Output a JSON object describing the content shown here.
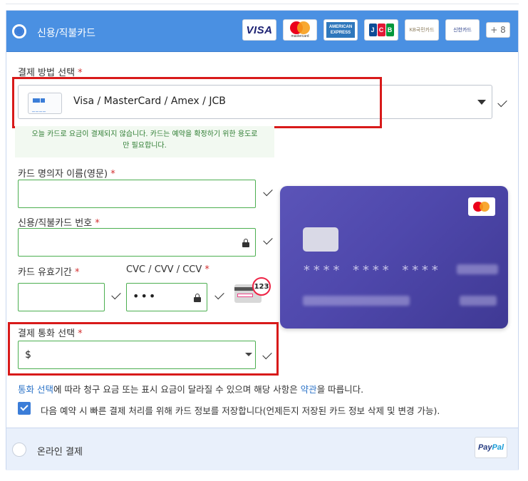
{
  "payment_header": {
    "label": "신용/직불카드",
    "selected": true,
    "logos": [
      "VISA",
      "mastercard",
      "AMERICAN EXPRESS",
      "JCB",
      "KB국민카드",
      "신한카드"
    ],
    "more_badge": "+ 8"
  },
  "method_select": {
    "label": "결제 방법 선택",
    "value": "Visa / MasterCard / Amex / JCB",
    "card_digits": "____"
  },
  "notice": {
    "line1": "오늘 카드로 요금이 결제되지 않습니다. 카드는 예약을 확정하기 위한 용도로",
    "line2": "만 필요합니다."
  },
  "fields": {
    "card_name_label": "카드 명의자 이름(영문)",
    "card_number_label": "신용/직불카드 번호",
    "expiry_label": "카드 유효기간",
    "cvc_label": "CVC / CVV / CCV",
    "cvc_value": "•••",
    "cvc_icon_text": "123"
  },
  "preview_card": {
    "number_masked": "**** **** ****"
  },
  "currency": {
    "label": "결제 통화 선택",
    "value": "$"
  },
  "info": {
    "link1": "통화 선택",
    "text1": "에 따라 청구 요금 또는 표시 요금이 달라질 수 있으며 해당 사항은 ",
    "link2": "약관",
    "text2": "을 따릅니다."
  },
  "save_card": {
    "checked": true,
    "label": "다음 예약 시 빠른 결제 처리를 위해 카드 정보를 저장합니다(언제든지 저장된 카드 정보 삭제 및 변경 가능)."
  },
  "online_payment": {
    "label": "온라인 결제",
    "paypal_a": "Pay",
    "paypal_b": "Pal"
  },
  "colors": {
    "header_blue": "#4a90e2",
    "valid_green": "#4caf50",
    "highlight_red": "#d81a1a",
    "card_purple": "#4f48ac"
  }
}
